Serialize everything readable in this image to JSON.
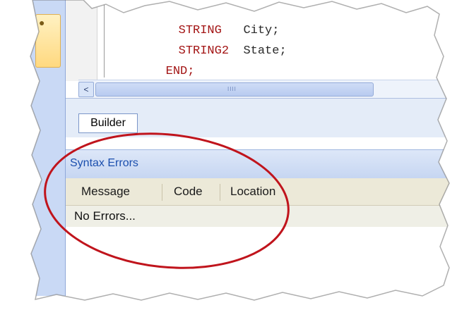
{
  "editor": {
    "code_lines": [
      {
        "keyword": "STRING",
        "identifier": "City;"
      },
      {
        "keyword": "STRING2",
        "identifier": "State;"
      },
      {
        "keyword": "END;",
        "identifier": ""
      }
    ]
  },
  "scrollbar": {
    "left_arrow": "<",
    "thumb_grip": "IIII"
  },
  "builder_tab": {
    "label": "Builder"
  },
  "syntax_errors": {
    "title": "Syntax Errors",
    "columns": [
      "Message",
      "Code",
      "Location"
    ],
    "rows": [
      "No Errors..."
    ]
  },
  "colors": {
    "sidebar": "#c9d9f5",
    "panel_header": "#c6d6f2",
    "title_text": "#1b4fae",
    "keyword_text": "#a31515",
    "highlight_ring": "#c0141c",
    "grid_header": "#ece9d8"
  },
  "icons": {
    "bookmark": "bookmark-icon"
  }
}
